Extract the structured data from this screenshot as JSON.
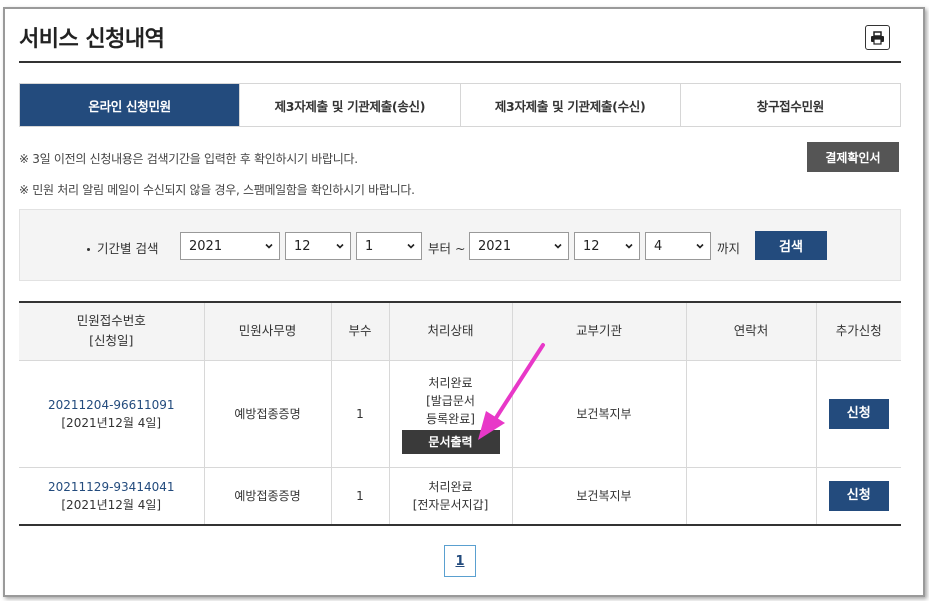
{
  "header": {
    "title": "서비스 신청내역",
    "print_icon": "printer-icon"
  },
  "tabs": [
    {
      "label": "온라인 신청민원",
      "active": true
    },
    {
      "label": "제3자제출 및 기관제출(송신)",
      "active": false
    },
    {
      "label": "제3자제출 및 기관제출(수신)",
      "active": false
    },
    {
      "label": "창구접수민원",
      "active": false
    }
  ],
  "notices": [
    "※ 3일 이전의 신청내용은 검색기간을 입력한 후 확인하시기 바랍니다.",
    "※ 민원 처리 알림 메일이 수신되지 않을 경우, 스팸메일함을 확인하시기 바랍니다."
  ],
  "receipt_button": "결제확인서",
  "search": {
    "label": "기간별 검색",
    "from_year": "2021",
    "from_month": "12",
    "from_day": "1",
    "from_text": "부터 ~",
    "to_year": "2021",
    "to_month": "12",
    "to_day": "4",
    "to_text": "까지",
    "button": "검색"
  },
  "table": {
    "headers": {
      "receipt_no_line1": "민원접수번호",
      "receipt_no_line2": "[신청일]",
      "service": "민원사무명",
      "copies": "부수",
      "status": "처리상태",
      "agency": "교부기관",
      "contact": "연락처",
      "extra": "추가신청"
    },
    "rows": [
      {
        "receipt_no": "20211204-96611091",
        "date": "[2021년12월 4일]",
        "service": "예방접종증명",
        "copies": "1",
        "status_line1": "처리완료",
        "status_line2": "[발급문서",
        "status_line3": "등록완료]",
        "doc_button": "문서출력",
        "agency": "보건복지부",
        "contact": "",
        "apply_button": "신청"
      },
      {
        "receipt_no": "20211129-93414041",
        "date": "[2021년12월 4일]",
        "service": "예방접종증명",
        "copies": "1",
        "status_line1": "처리완료",
        "status_line2": "[전자문서지갑]",
        "agency": "보건복지부",
        "contact": "",
        "apply_button": "신청"
      }
    ]
  },
  "pagination": {
    "current": "1"
  },
  "colors": {
    "primary": "#234b7d",
    "annotation_arrow": "#e838c8",
    "dark_button": "#3a3a3a"
  }
}
